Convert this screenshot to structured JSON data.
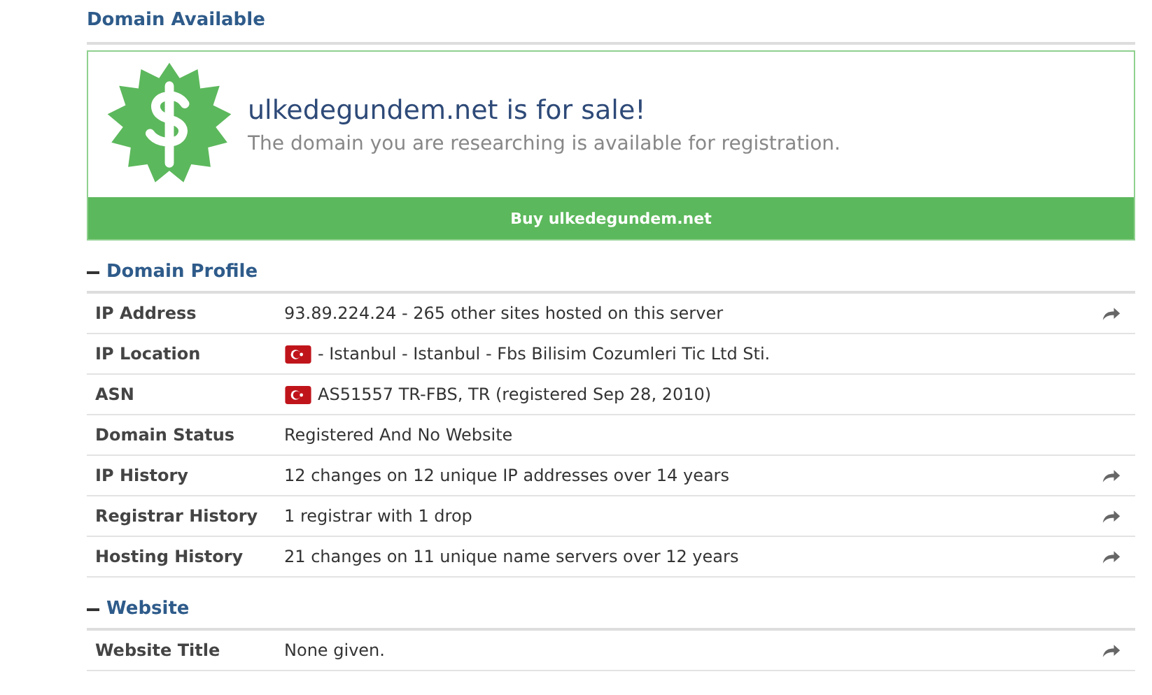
{
  "header": {
    "title": "Domain Available"
  },
  "sale": {
    "headline": "ulkedegundem.net is for sale!",
    "subtitle": "The domain you are researching is available for registration.",
    "button": "Buy ulkedegundem.net"
  },
  "sections": [
    {
      "title": "Domain Profile",
      "expanded": true,
      "rows": [
        {
          "label": "IP Address",
          "value": "93.89.224.24 - 265 other sites hosted on this server",
          "flag": false,
          "link": true
        },
        {
          "label": "IP Location",
          "value": "- Istanbul - Istanbul - Fbs Bilisim Cozumleri Tic Ltd Sti.",
          "flag": true,
          "link": false
        },
        {
          "label": "ASN",
          "value": "AS51557 TR-FBS, TR (registered Sep 28, 2010)",
          "flag": true,
          "link": false
        },
        {
          "label": "Domain Status",
          "value": "Registered And No Website",
          "flag": false,
          "link": false
        },
        {
          "label": "IP History",
          "value": "12 changes on 12 unique IP addresses over 14 years",
          "flag": false,
          "link": true
        },
        {
          "label": "Registrar History",
          "value": "1 registrar with 1 drop",
          "flag": false,
          "link": true
        },
        {
          "label": "Hosting History",
          "value": "21 changes on 11 unique name servers over 12 years",
          "flag": false,
          "link": true
        }
      ]
    },
    {
      "title": "Website",
      "expanded": true,
      "rows": [
        {
          "label": "Website Title",
          "value": "None given.",
          "flag": false,
          "link": true
        }
      ]
    }
  ]
}
